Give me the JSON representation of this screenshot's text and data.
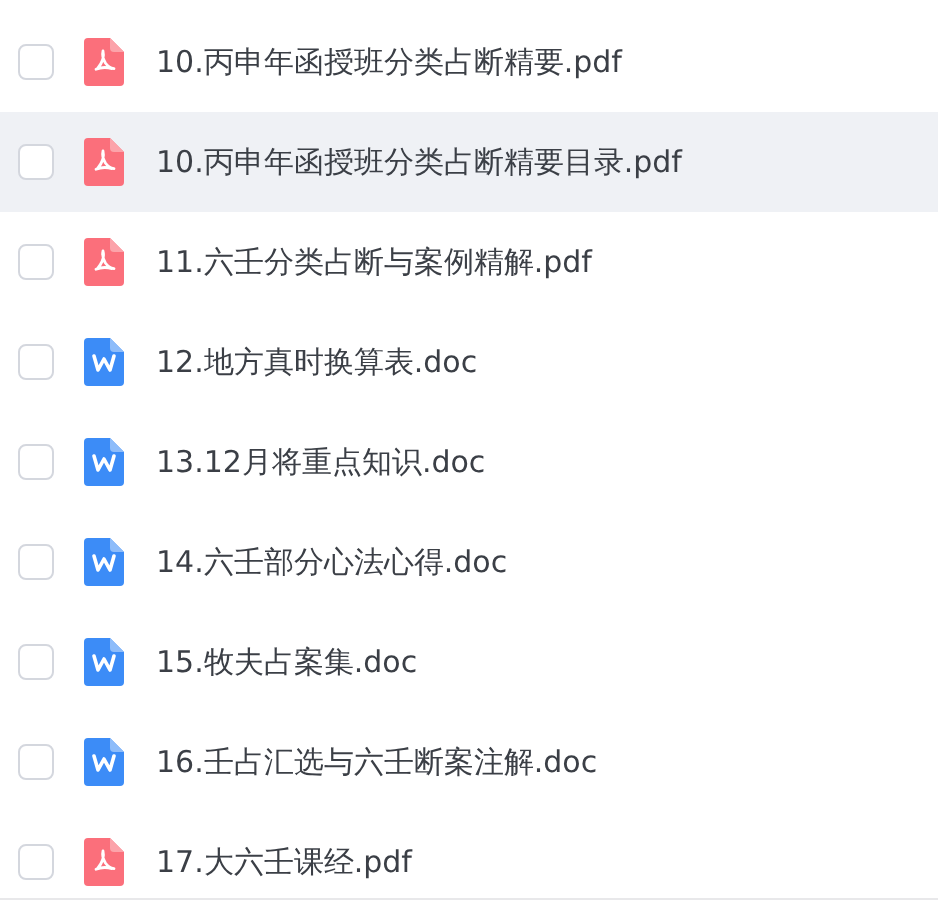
{
  "files": [
    {
      "name": "10.丙申年函授班分类占断精要.pdf",
      "kind": "pdf",
      "checked": false,
      "selected": false
    },
    {
      "name": "10.丙申年函授班分类占断精要目录.pdf",
      "kind": "pdf",
      "checked": false,
      "selected": true
    },
    {
      "name": "11.六壬分类占断与案例精解.pdf",
      "kind": "pdf",
      "checked": false,
      "selected": false
    },
    {
      "name": "12.地方真时换算表.doc",
      "kind": "doc",
      "checked": false,
      "selected": false
    },
    {
      "name": "13.12月将重点知识.doc",
      "kind": "doc",
      "checked": false,
      "selected": false
    },
    {
      "name": "14.六壬部分心法心得.doc",
      "kind": "doc",
      "checked": false,
      "selected": false
    },
    {
      "name": "15.牧夫占案集.doc",
      "kind": "doc",
      "checked": false,
      "selected": false
    },
    {
      "name": "16.壬占汇选与六壬断案注解.doc",
      "kind": "doc",
      "checked": false,
      "selected": false
    },
    {
      "name": "17.大六壬课经.pdf",
      "kind": "pdf",
      "checked": false,
      "selected": false
    }
  ]
}
